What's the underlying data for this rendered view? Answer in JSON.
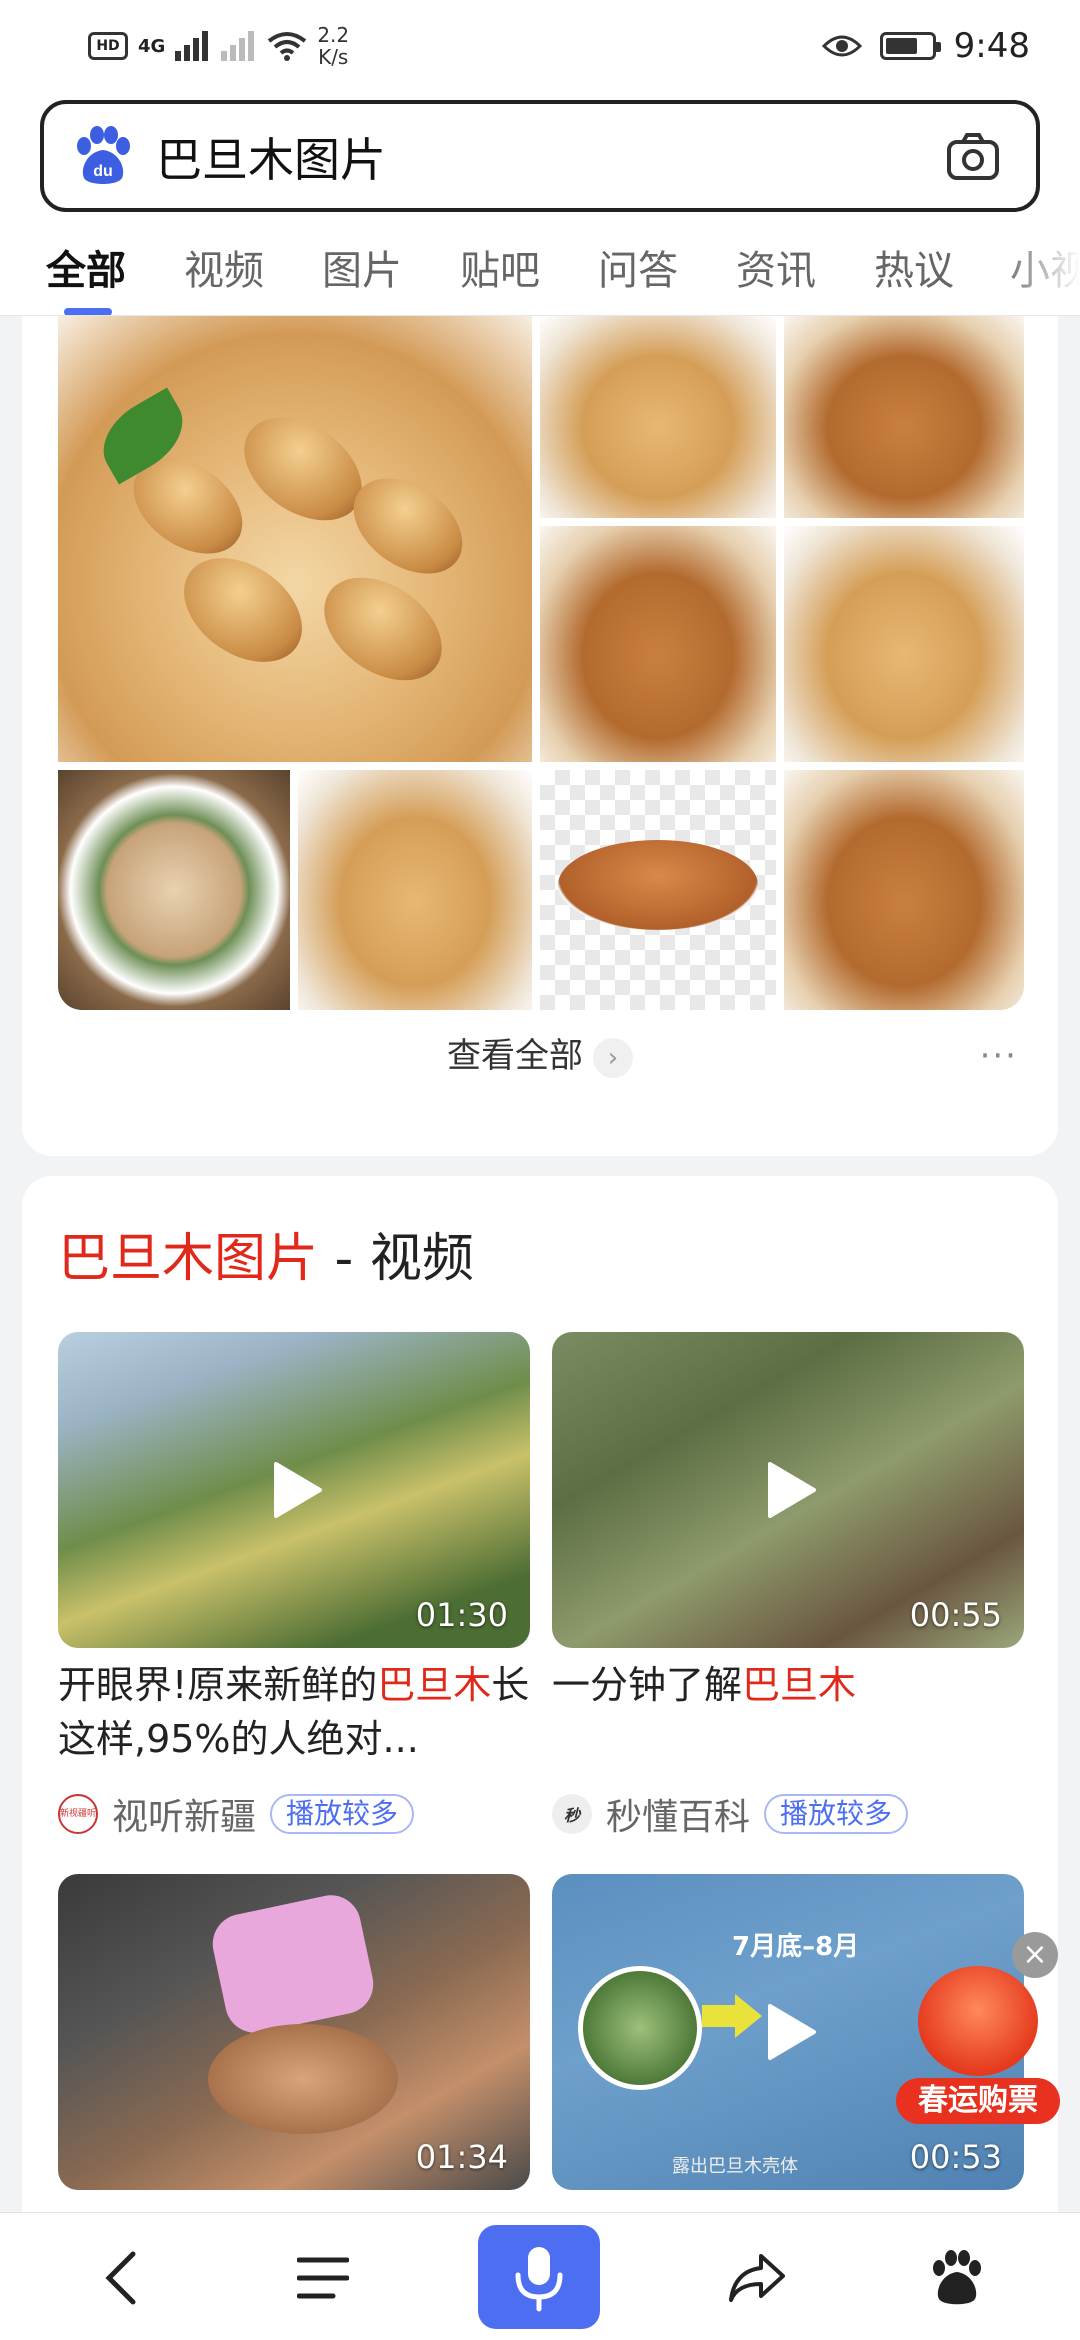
{
  "status_bar": {
    "hd": "HD",
    "network": "4G",
    "speed_value": "2.2",
    "speed_unit": "K/s",
    "time": "9:48",
    "battery_level": 0.7
  },
  "search": {
    "query": "巴旦木图片",
    "logo_text": "du"
  },
  "tabs": [
    "全部",
    "视频",
    "图片",
    "贴吧",
    "问答",
    "资讯",
    "热议",
    "小视"
  ],
  "active_tab": "全部",
  "image_section": {
    "view_all": "查看全部",
    "more": "···"
  },
  "video_section": {
    "title_highlight": "巴旦木图片",
    "title_rest": " - 视频",
    "videos": [
      {
        "title_pre": "开眼界!原来新鲜的",
        "title_hl": "巴旦木",
        "title_post": "长这样,95%的人绝对...",
        "duration": "01:30",
        "source": "视听新疆",
        "avatar_text": "新视疆听",
        "tag": "播放较多"
      },
      {
        "title_pre": "一分钟了解",
        "title_hl": "巴旦木",
        "title_post": "",
        "duration": "00:55",
        "source": "秒懂百科",
        "avatar_text": "秒",
        "tag": "播放较多"
      },
      {
        "duration": "01:34"
      },
      {
        "duration": "00:53",
        "overlay_month": "7月底–8月",
        "overlay_caption": "露出巴旦木壳体"
      }
    ]
  },
  "promo": {
    "label": "春运购票"
  },
  "colors": {
    "accent": "#4e6ef2",
    "highlight": "#e0291b"
  }
}
